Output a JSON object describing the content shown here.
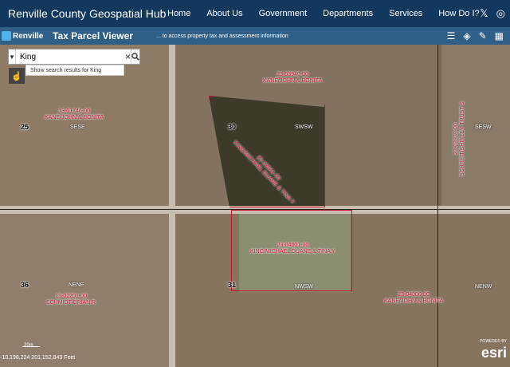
{
  "site": {
    "title": "Renville County Geospatial Hub",
    "nav": [
      "Home",
      "About Us",
      "Government",
      "Departments",
      "Services",
      "How Do I?"
    ]
  },
  "app": {
    "logo_text": "Renville",
    "title": "Tax Parcel Viewer",
    "subtitle": "... to access property tax and assessment information"
  },
  "search": {
    "value": "King",
    "suggestion": "Show search results for King"
  },
  "parcels": [
    {
      "id": "23-03940-00",
      "owner": "KANE/JOHN & BONITA"
    },
    {
      "id": "13-01746-00",
      "owner": "KANE/JOHN & BONITA"
    },
    {
      "id": "23-03941-00",
      "owner": "KING/MICHAEL DUANE & TINA Y"
    },
    {
      "id": "23-03939-00",
      "owner": "SCHREIT/SHIRLEY TRUST &"
    },
    {
      "id": "23-04001-00",
      "owner": "KING/MICHAEL DUANE & TINA Y"
    },
    {
      "id": "13-02201-00",
      "owner": "SCHMIDT/BRIAN R"
    },
    {
      "id": "23-04000-00",
      "owner": "KANE/JOHN & BONITA"
    }
  ],
  "sections": [
    "25",
    "30",
    "36",
    "31"
  ],
  "quarters": [
    "SESE",
    "SWSW",
    "SESW",
    "NENE",
    "NWSW",
    "NENW"
  ],
  "map_footer": {
    "scale_label": "20m",
    "coordinates": "-10,198,224 201,152,849 Feet",
    "powered": "POWERED BY",
    "esri": "esri"
  }
}
